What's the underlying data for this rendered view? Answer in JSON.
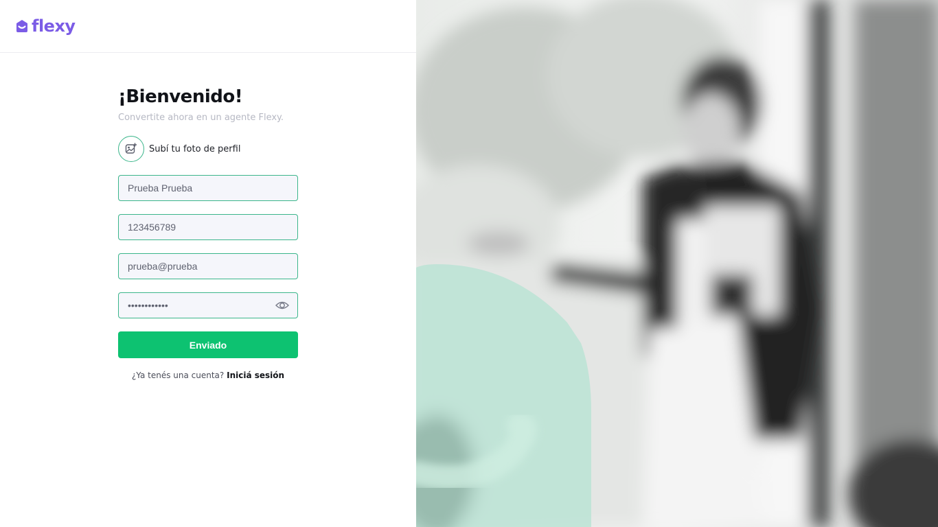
{
  "brand": {
    "name": "flexy",
    "color": "#7b5ce6"
  },
  "welcome": {
    "title": "¡Bienvenido!",
    "subtitle": "Convertite ahora en un agente Flexy."
  },
  "upload": {
    "label": "Subí tu foto de perfil",
    "icon": "image-add-icon"
  },
  "form": {
    "name_value": "Prueba Prueba",
    "phone_value": "123456789",
    "email_value": "prueba@prueba",
    "password_value": "••••••••••••",
    "password_toggle_icon": "eye-icon",
    "submit_label": "Enviado"
  },
  "login": {
    "prompt": "¿Ya tenés una cuenta?",
    "link_label": "Iniciá sesión"
  },
  "colors": {
    "accent_green": "#0dc271",
    "field_border": "#3ab58a",
    "field_bg": "#f5f6fb",
    "mint_shape": "#b7e3d3"
  },
  "hero": {
    "description_icon": "presenter-photo"
  }
}
